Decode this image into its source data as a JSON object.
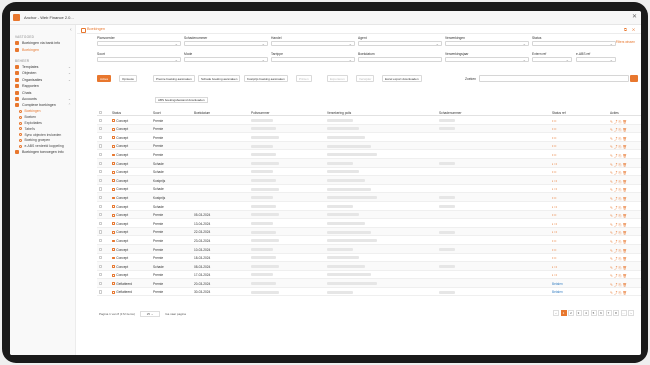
{
  "window": {
    "title": "Anchor - Web Finance 2.0..."
  },
  "sidebar": {
    "section1": "VASTGOED",
    "top_items": [
      {
        "label": "Boekingen via bank info"
      },
      {
        "label": "Boekingen"
      }
    ],
    "section2": "BEHEER",
    "items": [
      {
        "label": "Templates"
      },
      {
        "label": "Objecten"
      },
      {
        "label": "Organisaties"
      },
      {
        "label": "Rapporten"
      },
      {
        "label": "Chats"
      },
      {
        "label": "Accounts"
      },
      {
        "label": "Complexe boekingen"
      }
    ],
    "subitems": [
      {
        "label": "Boekingen"
      },
      {
        "label": "Boeken"
      },
      {
        "label": "Exploitaties"
      },
      {
        "label": "Tabel's"
      },
      {
        "label": "Sync objecten invloeden"
      },
      {
        "label": "Boeking groepen"
      },
      {
        "label": "e-ABS verdeeld koppeling"
      }
    ],
    "bottom_item": "Boekingen toevoegen info"
  },
  "tab": {
    "label": "Boekingen"
  },
  "filters": {
    "row1": [
      "Planvoerder",
      "Schadenummer",
      "Handel",
      "Agent",
      "Verwerkingen",
      "Status"
    ],
    "row2": [
      "Soort",
      "Mode",
      "Tarrippe",
      "Boekdatum",
      "Verwerkingsjaar",
      "Extern ref",
      "e-ABS ref"
    ],
    "clear": "Filters wissen"
  },
  "toolbar": {
    "buttons": [
      "Acties",
      "Opnieuw",
      "Premie boeking aanmaken",
      "Schade boeking aanmaken",
      "Kostprijs boeking aanmaken",
      "Printen",
      "Exporteren",
      "Verwijder",
      "Excel export downloaden"
    ],
    "search_label": "Zoeken",
    "mini": "ABS boekingsbestand downloaden"
  },
  "table": {
    "headers": [
      "Status",
      "Soort",
      "Boekdatum",
      "Polisnummer",
      "Verzekering polis",
      "Schadenummer",
      "Status ref",
      "Acties"
    ],
    "rows": [
      {
        "status": "Concept",
        "soort": "Premie",
        "datum": "",
        "ref": "•••"
      },
      {
        "status": "Concept",
        "soort": "Premie",
        "datum": "",
        "ref": "•••"
      },
      {
        "status": "Concept",
        "soort": "Premie",
        "datum": "",
        "ref": "•••"
      },
      {
        "status": "Concept",
        "soort": "Premie",
        "datum": "",
        "ref": "•••"
      },
      {
        "status": "Concept",
        "soort": "Premie",
        "datum": "",
        "ref": "•••"
      },
      {
        "status": "Concept",
        "soort": "Schade",
        "datum": "",
        "ref": "◐••"
      },
      {
        "status": "Concept",
        "soort": "Schade",
        "datum": "",
        "ref": "•••"
      },
      {
        "status": "Concept",
        "soort": "Kostprijs",
        "datum": "",
        "ref": "◐••"
      },
      {
        "status": "Concept",
        "soort": "Schade",
        "datum": "",
        "ref": "◐••"
      },
      {
        "status": "Concept",
        "soort": "Kostprijs",
        "datum": "",
        "ref": "•••"
      },
      {
        "status": "Concept",
        "soort": "Schade",
        "datum": "",
        "ref": "◐••"
      },
      {
        "status": "Concept",
        "soort": "Premie",
        "datum": "05-03-2024",
        "ref": "•••"
      },
      {
        "status": "Concept",
        "soort": "Premie",
        "datum": "13-04-2024",
        "ref": "◐••"
      },
      {
        "status": "Concept",
        "soort": "Premie",
        "datum": "22-03-2024",
        "ref": "◐••"
      },
      {
        "status": "Concept",
        "soort": "Premie",
        "datum": "23-03-2024",
        "ref": "•••"
      },
      {
        "status": "Concept",
        "soort": "Premie",
        "datum": "10-03-2024",
        "ref": "•••"
      },
      {
        "status": "Concept",
        "soort": "Premie",
        "datum": "18-03-2024",
        "ref": "•••"
      },
      {
        "status": "Concept",
        "soort": "Schade",
        "datum": "08-03-2024",
        "ref": "◐••"
      },
      {
        "status": "Concept",
        "soort": "Premie",
        "datum": "17-03-2024",
        "ref": "◐••"
      },
      {
        "status": "Gefiatteerd",
        "soort": "Premie",
        "datum": "20-03-2024",
        "ref": "Betalen"
      },
      {
        "status": "Gefiatteerd",
        "soort": "Premie",
        "datum": "30-03-2024",
        "ref": "Betalen"
      }
    ]
  },
  "pagination": {
    "info": "Pagina 1 van 8 (172 items)",
    "per_page": "Ga naar pagina",
    "pages": [
      "‹",
      "1",
      "2",
      "3",
      "4",
      "5",
      "6",
      "7",
      "8",
      "...",
      "›"
    ]
  },
  "colors": {
    "accent": "#e8772e"
  }
}
